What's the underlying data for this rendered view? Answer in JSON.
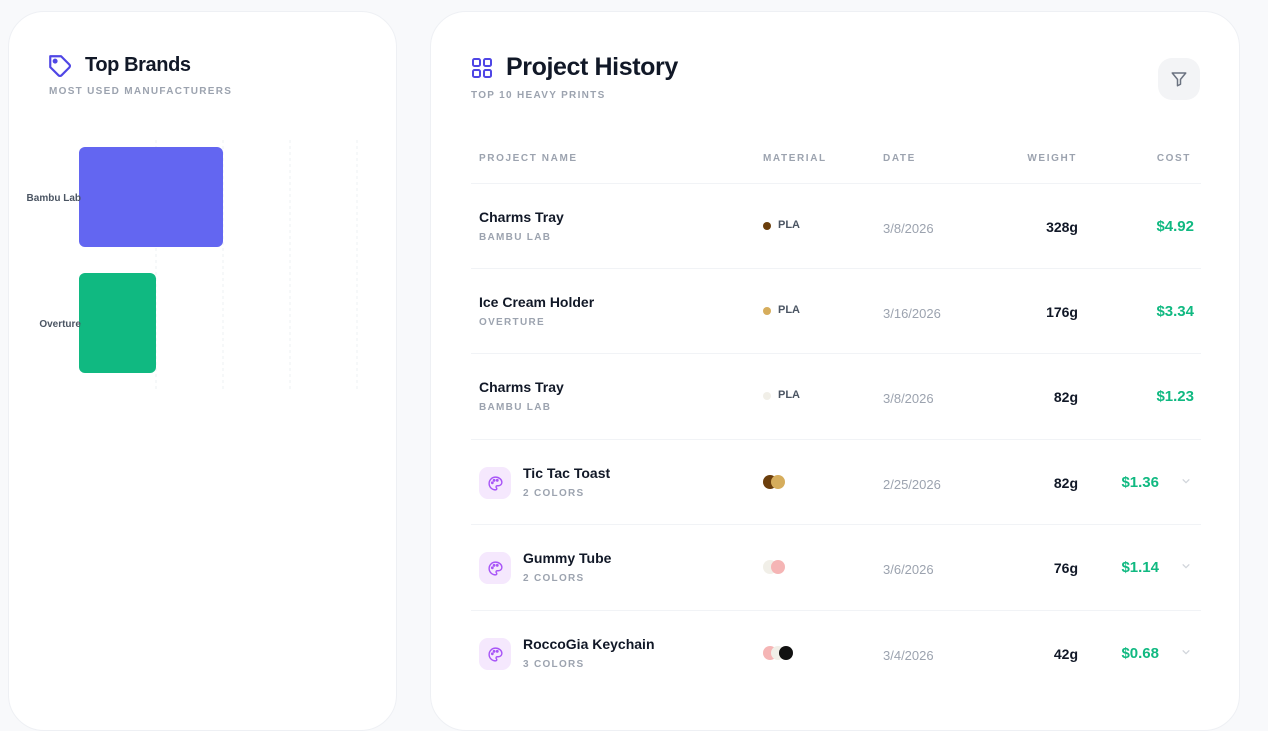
{
  "brands": {
    "title": "Top Brands",
    "subtitle": "MOST USED MANUFACTURERS",
    "icon": "tag-icon"
  },
  "chart_data": {
    "type": "bar",
    "orientation": "horizontal",
    "categories": [
      "Bambu Lab",
      "Overture"
    ],
    "values": [
      2,
      1
    ],
    "colors": [
      "#6366f1",
      "#10b981"
    ],
    "xlim": [
      0,
      4
    ],
    "grid": true
  },
  "history": {
    "title": "Project History",
    "subtitle": "TOP 10 HEAVY PRINTS",
    "icon": "grid-icon",
    "filter_icon": "filter-icon",
    "columns": {
      "name": "PROJECT NAME",
      "material": "MATERIAL",
      "date": "DATE",
      "weight": "WEIGHT",
      "cost": "COST"
    },
    "rows": [
      {
        "name": "Charms Tray",
        "sub": "BAMBU LAB",
        "material": "PLA",
        "color": "#6b3e0c",
        "date": "3/8/2026",
        "weight": "328g",
        "cost": "$4.92"
      },
      {
        "name": "Ice Cream Holder",
        "sub": "OVERTURE",
        "material": "PLA",
        "color": "#d6ad5c",
        "date": "3/16/2026",
        "weight": "176g",
        "cost": "$3.34"
      },
      {
        "name": "Charms Tray",
        "sub": "BAMBU LAB",
        "material": "PLA",
        "color": "#f1efe8",
        "date": "3/8/2026",
        "weight": "82g",
        "cost": "$1.23"
      },
      {
        "name": "Tic Tac Toast",
        "sub": "2 COLORS",
        "swatches": [
          "#6b3e0c",
          "#d6ad5c"
        ],
        "date": "2/25/2026",
        "weight": "82g",
        "cost": "$1.36"
      },
      {
        "name": "Gummy Tube",
        "sub": "2 COLORS",
        "swatches": [
          "#f1efe8",
          "#f5b5b5"
        ],
        "date": "3/6/2026",
        "weight": "76g",
        "cost": "$1.14"
      },
      {
        "name": "RoccoGia Keychain",
        "sub": "3 COLORS",
        "swatches": [
          "#f5b5b5",
          "#f1efe8",
          "#111111"
        ],
        "date": "3/4/2026",
        "weight": "42g",
        "cost": "$0.68"
      }
    ]
  }
}
